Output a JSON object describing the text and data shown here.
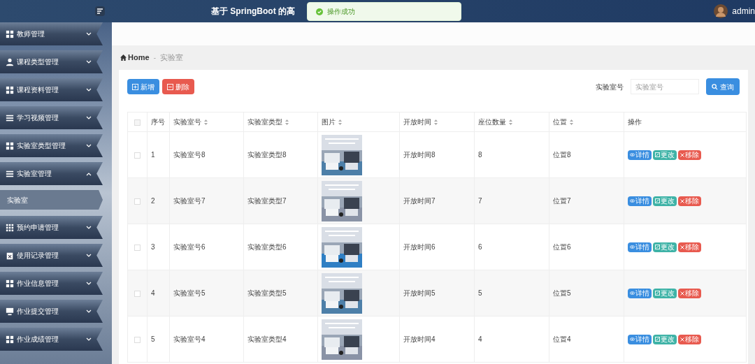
{
  "header": {
    "title": "基于 SpringBoot 的高",
    "user": "admin"
  },
  "toast": {
    "text": "操作成功"
  },
  "sidebar": {
    "items": [
      {
        "label": "教师管理",
        "kind": "grid",
        "expanded": false
      },
      {
        "label": "课程类型管理",
        "kind": "person",
        "expanded": false
      },
      {
        "label": "课程资料管理",
        "kind": "grid",
        "expanded": false
      },
      {
        "label": "学习视频管理",
        "kind": "list",
        "expanded": false
      },
      {
        "label": "实验室类型管理",
        "kind": "grid",
        "expanded": false
      },
      {
        "label": "实验室管理",
        "kind": "list",
        "expanded": true,
        "children": [
          {
            "label": "实验室"
          }
        ]
      },
      {
        "label": "预约申请管理",
        "kind": "grid9",
        "expanded": false
      },
      {
        "label": "使用记录管理",
        "kind": "clipboard",
        "expanded": false
      },
      {
        "label": "作业信息管理",
        "kind": "grid",
        "expanded": false
      },
      {
        "label": "作业提交管理",
        "kind": "monitor",
        "expanded": false
      },
      {
        "label": "作业成绩管理",
        "kind": "grid",
        "expanded": false
      }
    ]
  },
  "breadcrumb": {
    "home": "Home",
    "separator": "-",
    "current": "实验室"
  },
  "toolbar": {
    "add": "新增",
    "delete": "删除",
    "search_label": "实验室号",
    "search_placeholder": "实验室号",
    "query": "查询"
  },
  "table": {
    "select_all_checked": false,
    "columns": [
      {
        "label": "序号",
        "sortable": false
      },
      {
        "label": "实验室号",
        "sortable": true
      },
      {
        "label": "实验室类型",
        "sortable": true
      },
      {
        "label": "图片",
        "sortable": true
      },
      {
        "label": "开放时间",
        "sortable": true
      },
      {
        "label": "座位数量",
        "sortable": true
      },
      {
        "label": "位置",
        "sortable": true
      },
      {
        "label": "操作",
        "sortable": false
      }
    ],
    "rows": [
      {
        "checked": false,
        "cells": [
          "1",
          "实验室号8",
          "实验室类型8",
          {
            "kind": "picture"
          },
          "开放时间8",
          "8",
          "位置8"
        ],
        "actions": [
          "详情",
          "更改",
          "移除"
        ]
      },
      {
        "checked": false,
        "cells": [
          "2",
          "实验室号7",
          "实验室类型7",
          {
            "kind": "picture"
          },
          "开放时间7",
          "7",
          "位置7"
        ],
        "actions": [
          "详情",
          "更改",
          "移除"
        ]
      },
      {
        "checked": false,
        "cells": [
          "3",
          "实验室号6",
          "实验室类型6",
          {
            "kind": "picture"
          },
          "开放时间6",
          "6",
          "位置6"
        ],
        "actions": [
          "详情",
          "更改",
          "移除"
        ]
      },
      {
        "checked": false,
        "cells": [
          "4",
          "实验室号5",
          "实验室类型5",
          {
            "kind": "picture"
          },
          "开放时间5",
          "5",
          "位置5"
        ],
        "actions": [
          "详情",
          "更改",
          "移除"
        ]
      },
      {
        "checked": false,
        "cells": [
          "5",
          "实验室号4",
          "实验室类型4",
          {
            "kind": "picture"
          },
          "开放时间4",
          "4",
          "位置4"
        ],
        "actions": [
          "详情",
          "更改",
          "移除"
        ]
      }
    ]
  }
}
